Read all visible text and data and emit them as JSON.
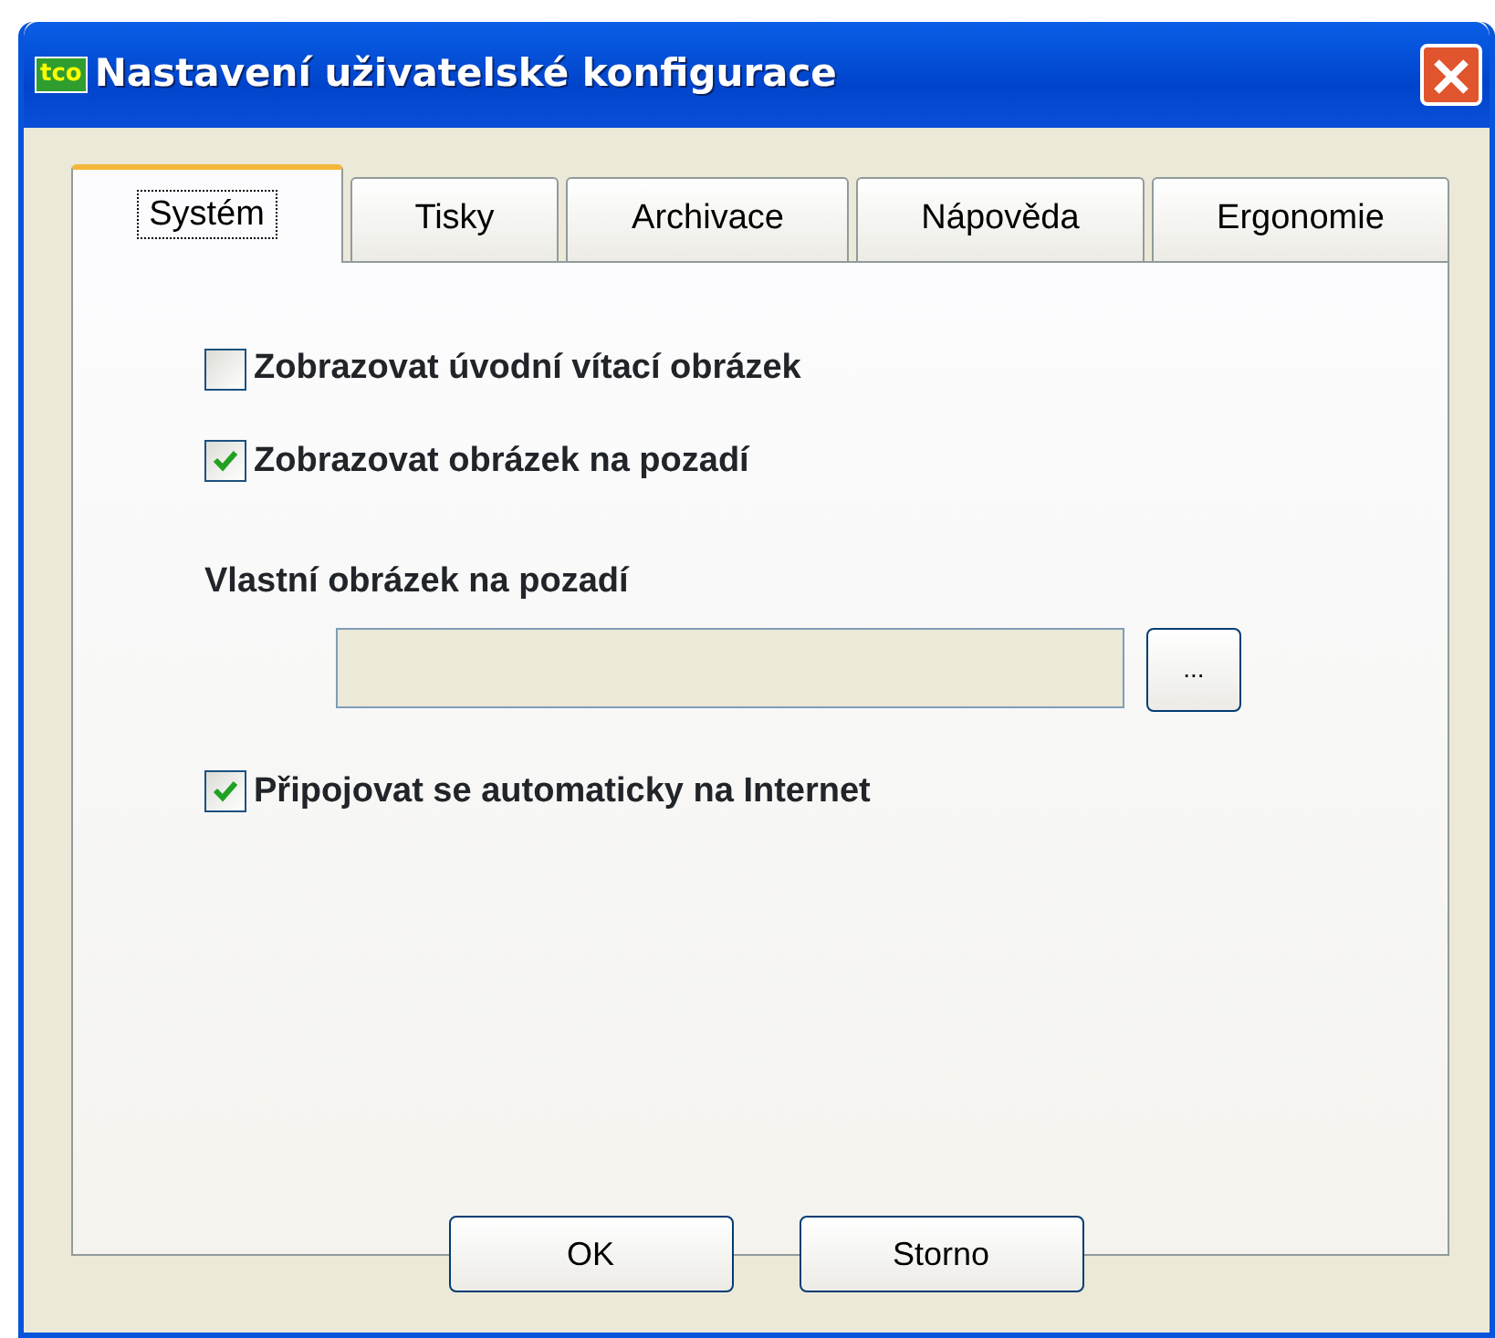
{
  "window": {
    "title": "Nastavení uživatelské konfigurace",
    "logo": "tco"
  },
  "tabs": [
    {
      "label": "Systém",
      "selected": true
    },
    {
      "label": "Tisky",
      "selected": false
    },
    {
      "label": "Archivace",
      "selected": false
    },
    {
      "label": "Nápověda",
      "selected": false
    },
    {
      "label": "Ergonomie",
      "selected": false
    }
  ],
  "options": [
    {
      "kind": "checkbox",
      "label": "Zobrazovat úvodní vítací obrázek",
      "checked": false
    },
    {
      "kind": "checkbox",
      "label": "Zobrazovat obrázek na pozadí",
      "checked": true
    },
    {
      "kind": "heading",
      "label": "Vlastní obrázek na pozadí"
    },
    {
      "kind": "file",
      "button": "..."
    },
    {
      "kind": "checkbox",
      "label": "Připojovat se automaticky na Internet",
      "checked": true
    }
  ],
  "buttons": [
    "OK",
    "Storno"
  ]
}
